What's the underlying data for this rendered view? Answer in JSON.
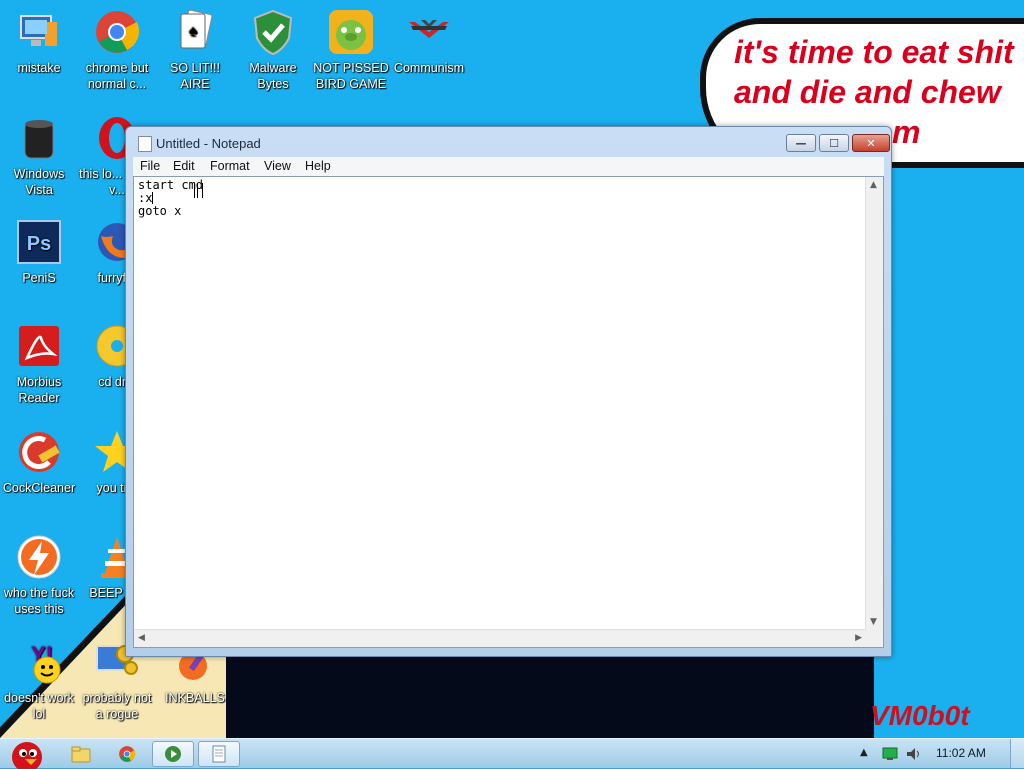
{
  "desktop": {
    "speech_bubble": [
      "it's time to eat shit",
      "and die and chew",
      "m"
    ],
    "watermark": "VM0b0t",
    "icons": [
      {
        "label": "mistake"
      },
      {
        "label": "chrome but normal c..."
      },
      {
        "label": "SO LIT!!! AIRE"
      },
      {
        "label": "Malware Bytes"
      },
      {
        "label": "NOT PISSED BIRD GAME"
      },
      {
        "label": "Communism"
      },
      {
        "label": "Windows Vista"
      },
      {
        "label": "this lo... like a v..."
      },
      {
        "label": "PeniS"
      },
      {
        "label": "furryf..."
      },
      {
        "label": "Morbius Reader"
      },
      {
        "label": "cd dr..."
      },
      {
        "label": "CockCleaner"
      },
      {
        "label": "you tr..."
      },
      {
        "label": "who the fuck uses this"
      },
      {
        "label": "BEEP B..."
      },
      {
        "label": "doesn't work lol"
      },
      {
        "label": "probably not a rogue"
      },
      {
        "label": "INKBALLS"
      }
    ]
  },
  "notepad": {
    "title": "Untitled - Notepad",
    "menu": [
      "File",
      "Edit",
      "Format",
      "View",
      "Help"
    ],
    "content_lines": [
      "start cmd",
      ":x",
      "goto x"
    ],
    "controls": {
      "minimize": "—",
      "maximize": "☐",
      "close": "✕"
    }
  },
  "taskbar": {
    "clock": "11:02 AM"
  },
  "colors": {
    "wallpaper": "#1ab0ef",
    "bubble_text": "#d8001c",
    "watermark": "#cc1122"
  }
}
